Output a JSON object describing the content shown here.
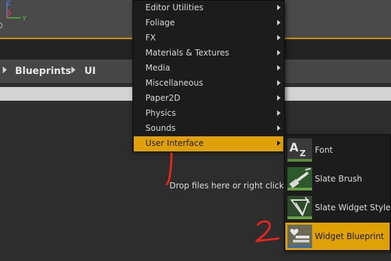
{
  "viewport": {
    "axis": {
      "z_label": "Z",
      "x_label": "X",
      "y_label": "Y"
    },
    "accent_color": "#d69800"
  },
  "breadcrumb": {
    "items": [
      "Blueprints",
      "UI"
    ]
  },
  "content": {
    "drop_text": "Drop files here or right click to c"
  },
  "context_menu": {
    "items": [
      {
        "label": "Editor Utilities",
        "has_submenu": true
      },
      {
        "label": "Foliage",
        "has_submenu": true
      },
      {
        "label": "FX",
        "has_submenu": true
      },
      {
        "label": "Materials & Textures",
        "has_submenu": true
      },
      {
        "label": "Media",
        "has_submenu": true
      },
      {
        "label": "Miscellaneous",
        "has_submenu": true
      },
      {
        "label": "Paper2D",
        "has_submenu": true
      },
      {
        "label": "Physics",
        "has_submenu": true
      },
      {
        "label": "Sounds",
        "has_submenu": true
      },
      {
        "label": "User Interface",
        "has_submenu": true,
        "active": true
      }
    ]
  },
  "submenu": {
    "items": [
      {
        "label": "Font",
        "icon": "font-icon"
      },
      {
        "label": "Slate Brush",
        "icon": "slate-brush-icon"
      },
      {
        "label": "Slate Widget Style",
        "icon": "slate-widget-style-icon"
      },
      {
        "label": "Widget Blueprint",
        "icon": "widget-blueprint-icon",
        "active": true
      }
    ]
  },
  "colors": {
    "highlight": "#e0a106",
    "annotation": "#e8251c",
    "menu_bg": "#1c1c1c"
  },
  "annotations": {
    "step_number": "2"
  }
}
